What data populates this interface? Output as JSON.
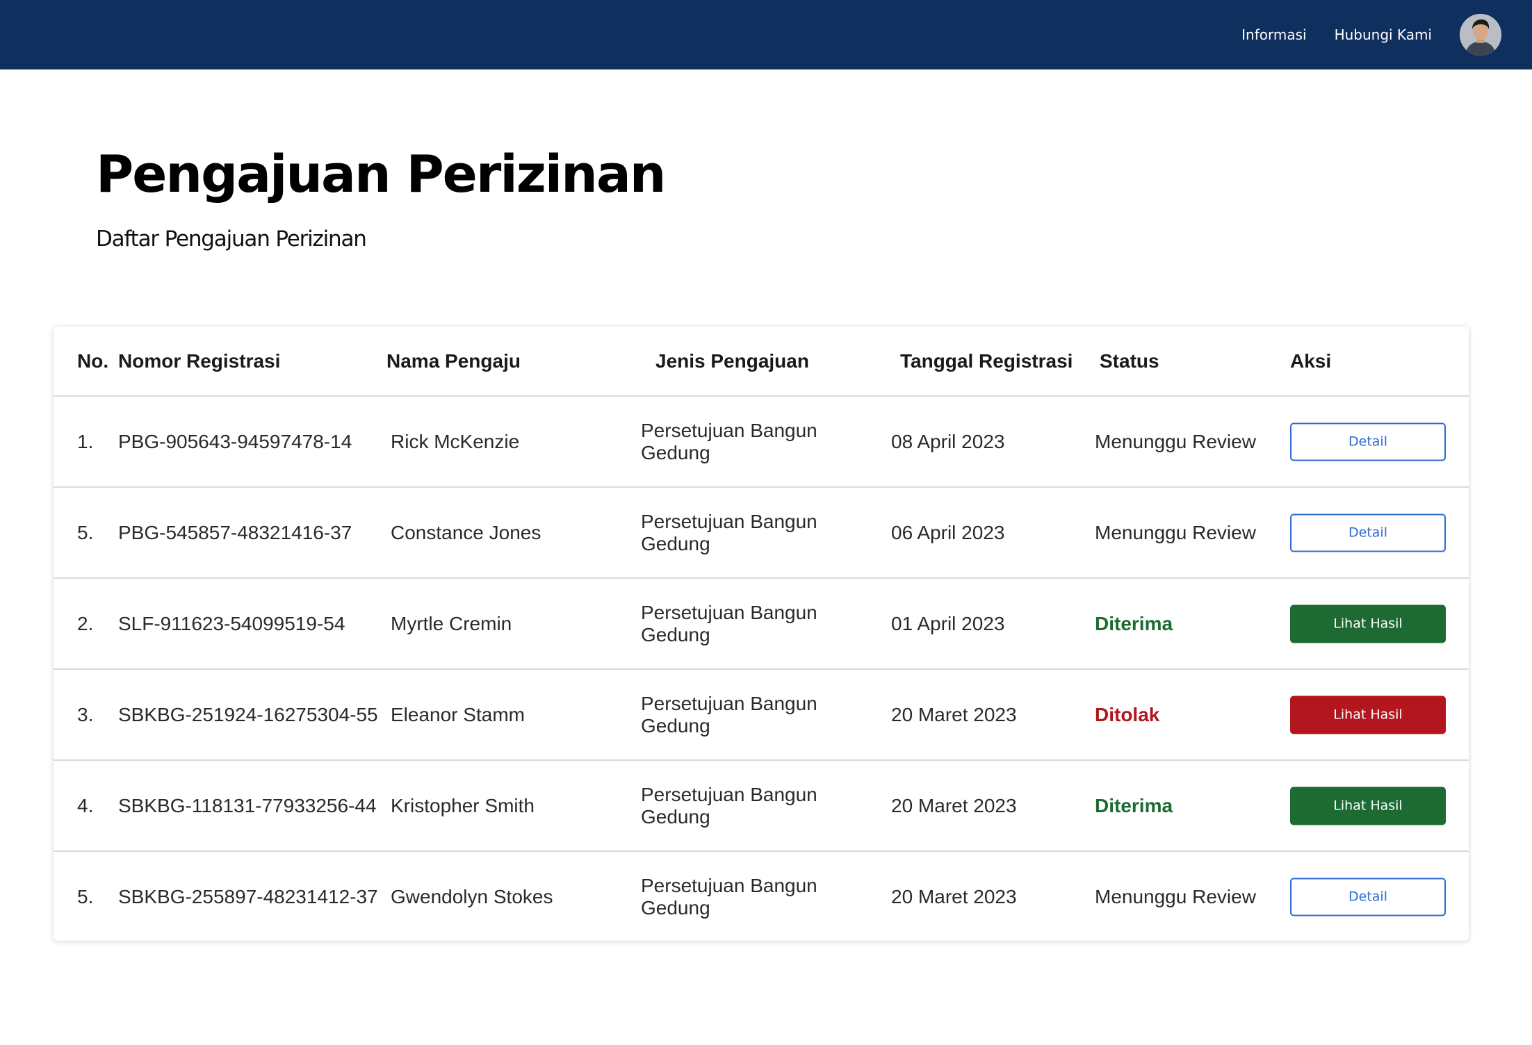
{
  "nav": {
    "items": [
      "Informasi",
      "Hubungi Kami"
    ]
  },
  "page": {
    "title": "Pengajuan Perizinan",
    "subtitle": "Daftar Pengajuan Perizinan"
  },
  "table": {
    "headers": {
      "no": "No.",
      "nomor": "Nomor Registrasi",
      "nama": "Nama Pengaju",
      "jenis": "Jenis Pengajuan",
      "tanggal": "Tanggal Registrasi",
      "status": "Status",
      "aksi": "Aksi"
    },
    "rows": [
      {
        "no": "1.",
        "nomor": "PBG-905643-94597478-14",
        "nama": "Rick McKenzie",
        "jenis": "Persetujuan Bangun Gedung",
        "tanggal": "08 April 2023",
        "status": "Menunggu Review",
        "status_kind": "pending",
        "action": "Detail"
      },
      {
        "no": "5.",
        "nomor": "PBG-545857-48321416-37",
        "nama": "Constance Jones",
        "jenis": "Persetujuan Bangun Gedung",
        "tanggal": "06 April 2023",
        "status": "Menunggu Review",
        "status_kind": "pending",
        "action": "Detail"
      },
      {
        "no": "2.",
        "nomor": "SLF-911623-54099519-54",
        "nama": "Myrtle Cremin",
        "jenis": "Persetujuan Bangun Gedung",
        "tanggal": "01 April 2023",
        "status": "Diterima",
        "status_kind": "accepted",
        "action": "Lihat Hasil"
      },
      {
        "no": "3.",
        "nomor": "SBKBG-251924-16275304-55",
        "nama": "Eleanor Stamm",
        "jenis": "Persetujuan Bangun Gedung",
        "tanggal": "20 Maret 2023",
        "status": "Ditolak",
        "status_kind": "rejected",
        "action": "Lihat Hasil"
      },
      {
        "no": "4.",
        "nomor": "SBKBG-118131-77933256-44",
        "nama": "Kristopher Smith",
        "jenis": "Persetujuan Bangun Gedung",
        "tanggal": "20 Maret 2023",
        "status": "Diterima",
        "status_kind": "accepted",
        "action": "Lihat Hasil"
      },
      {
        "no": "5.",
        "nomor": "SBKBG-255897-48231412-37",
        "nama": "Gwendolyn Stokes",
        "jenis": "Persetujuan Bangun Gedung",
        "tanggal": "20 Maret 2023",
        "status": "Menunggu Review",
        "status_kind": "pending",
        "action": "Detail"
      }
    ]
  },
  "colors": {
    "navbar": "#0f2f5f",
    "accepted": "#1d6b33",
    "rejected": "#b3161e",
    "link_blue": "#2d6bd0"
  },
  "icons": {
    "avatar": "user-avatar"
  }
}
